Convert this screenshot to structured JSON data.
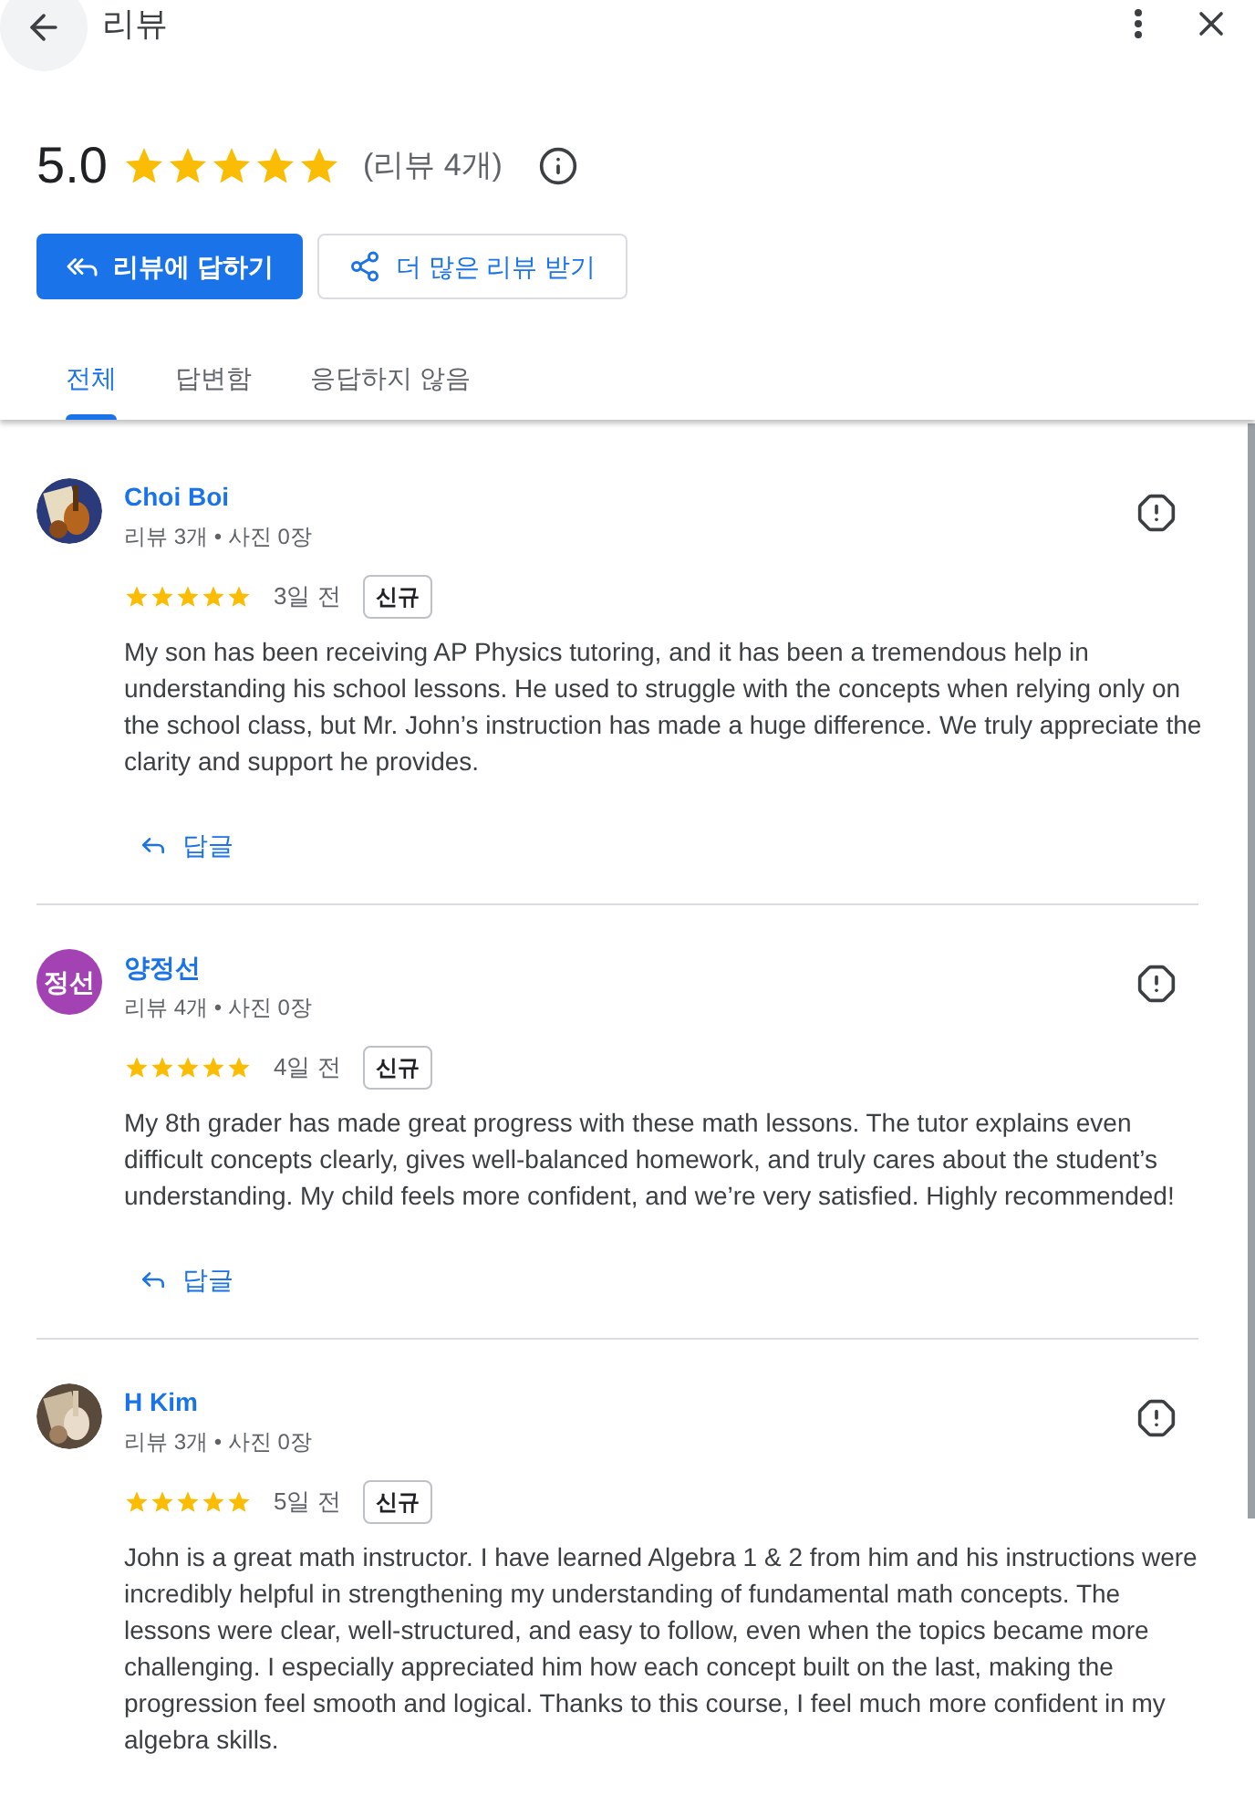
{
  "header": {
    "title": "리뷰"
  },
  "summary": {
    "rating": "5.0",
    "stars": 5,
    "count": "(리뷰 4개)"
  },
  "actions": {
    "reply_button": "리뷰에 답하기",
    "share_button": "더 많은 리뷰 받기"
  },
  "tabs": [
    {
      "label": "전체",
      "selected": true
    },
    {
      "label": "답변함",
      "selected": false
    },
    {
      "label": "응답하지 않음",
      "selected": false
    }
  ],
  "reviews": [
    {
      "name": "Choi Boi",
      "meta": "리뷰 3개 • 사진 0장",
      "stars": 5,
      "time": "3일 전",
      "badge": "신규",
      "text": "My son has been receiving AP Physics tutoring, and it has been a tremendous help in understanding his school lessons. He used to struggle with the concepts when relying only on the school class, but Mr. John’s instruction has made a huge difference. We truly appreciate the clarity and support he provides.",
      "reply": "답글"
    },
    {
      "avatar": {
        "kind": "initials",
        "initials": "정선",
        "color": "#a342b3"
      },
      "name": "양정선",
      "meta": "리뷰 4개 • 사진 0장",
      "stars": 5,
      "time": "4일 전",
      "badge": "신규",
      "text": "My 8th grader has made great progress with these math lessons. The tutor explains even difficult concepts clearly, gives well-balanced homework, and truly cares about the student’s understanding. My child feels more confident, and we’re very satisfied. Highly recommended!",
      "reply": "답글"
    },
    {
      "name": "H Kim",
      "meta": "리뷰 3개 • 사진 0장",
      "stars": 5,
      "time": "5일 전",
      "badge": "신규",
      "text": "John is a great math instructor. I have learned Algebra 1 & 2 from him and his instructions were incredibly helpful in strengthening my understanding of fundamental math concepts. The lessons were clear, well-structured, and easy to follow, even when the topics became more challenging. I especially appreciated him how each concept built on the last, making the progression feel smooth and logical. Thanks to this course, I feel much more confident in my algebra skills."
    }
  ]
}
